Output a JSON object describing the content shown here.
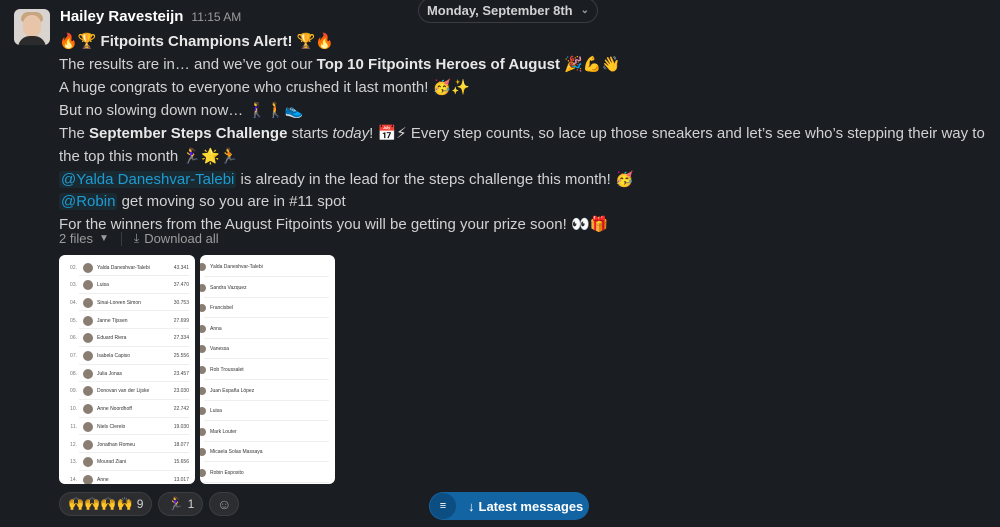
{
  "date_divider": {
    "label": "Monday, September 8th",
    "icon": "chevron-down-icon"
  },
  "message": {
    "sender": "Hailey Ravesteijn",
    "time": "11:15 AM",
    "line1": {
      "emoji_left": "🔥🏆",
      "text": "Fitpoints Champions Alert!",
      "emoji_right": "🏆🔥"
    },
    "line2": {
      "pre": "The results are in… and we’ve got our ",
      "bold": "Top 10 Fitpoints Heroes of August",
      "emoji": "🎉💪👋"
    },
    "line3": {
      "text": "A huge congrats to everyone who crushed it last month!",
      "emoji": "🥳✨"
    },
    "line4": {
      "text": "But no slowing down now…",
      "emoji": "🚶‍♀️🚶👟"
    },
    "line5": {
      "pre": "The ",
      "bold": "September Steps Challenge",
      "mid": " starts ",
      "italic": "today",
      "post": "!",
      "emoji1": "📅⚡",
      "rest": " Every step counts, so lace up those sneakers and let’s see who’s stepping their way to the top this month",
      "emoji2": "🏃‍♀️🌟🏃"
    },
    "line6": {
      "mention": "@Yalda Daneshvar-Talebi",
      "text": " is already in the lead for the steps challenge this month!",
      "emoji": "🥳"
    },
    "line7": {
      "mention": "@Robin",
      "text": " get moving so you are in #11 spot"
    },
    "line8": {
      "text": "For the winners from the August Fitpoints you will be getting your prize soon!",
      "emoji": "👀🎁"
    }
  },
  "files": {
    "count_label": "2 files",
    "download_label": "Download all"
  },
  "leaderboard": [
    {
      "rank": "02.",
      "name": "Yalda Daneshvar-Talebi",
      "points": "43.341"
    },
    {
      "rank": "03.",
      "name": "Luisa",
      "points": "37.470"
    },
    {
      "rank": "04.",
      "name": "Sinai-Loreen Simon",
      "points": "30.753"
    },
    {
      "rank": "05.",
      "name": "Janne Tijssen",
      "points": "27.699"
    },
    {
      "rank": "06.",
      "name": "Eduard Riera",
      "points": "27.334"
    },
    {
      "rank": "07.",
      "name": "Isabela Capiso",
      "points": "25.556"
    },
    {
      "rank": "08.",
      "name": "Julia Jonas",
      "points": "23.457"
    },
    {
      "rank": "09.",
      "name": "Donovan van der Lijske",
      "points": "23.030"
    },
    {
      "rank": "10.",
      "name": "Anne Noordhoff",
      "points": "22.742"
    },
    {
      "rank": "11.",
      "name": "Niels Clerelo",
      "points": "19.030"
    },
    {
      "rank": "12.",
      "name": "Jonathan Romeu",
      "points": "18.077"
    },
    {
      "rank": "13.",
      "name": "Mourad Ziani",
      "points": "15.656"
    },
    {
      "rank": "14.",
      "name": "Anne",
      "points": "13.017"
    }
  ],
  "steps_list": [
    "Yalda Daneshvar-Talebi",
    "Sandra Vazquez",
    "Francisbel",
    "Anna",
    "Vanessa",
    "Rob Troussalet",
    "Juan España López",
    "Luisa",
    "Mark Louter",
    "Micaela Solas Massaya",
    "Robin Esposito"
  ],
  "reactions": [
    {
      "emoji": "🙌🙌🙌🙌",
      "count": "9"
    },
    {
      "emoji": "🏃‍♀️",
      "count": "1"
    }
  ],
  "latest_messages": {
    "label": "Latest messages"
  }
}
